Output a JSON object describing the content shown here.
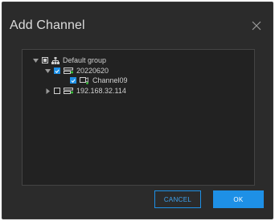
{
  "dialog": {
    "title": "Add Channel",
    "close_icon": "close-icon"
  },
  "tree": {
    "root": {
      "label": "Default group",
      "expanded": true,
      "checked": "partial",
      "icon": "group-hierarchy-icon"
    },
    "nodes": [
      {
        "label": "20220620",
        "expanded": true,
        "checked": true,
        "icon": "nvr-device-icon",
        "children": [
          {
            "label": "Channel09",
            "checked": true,
            "icon": "camera-channel-icon"
          }
        ]
      },
      {
        "label": "192.168.32.114",
        "expanded": false,
        "checked": false,
        "icon": "nvr-device-icon"
      }
    ]
  },
  "buttons": {
    "cancel_label": "CANCEL",
    "ok_label": "OK"
  },
  "colors": {
    "dialog_bg": "#2b2b2b",
    "panel_bg": "#222222",
    "accent": "#1e90e6",
    "device_green": "#37c23a"
  }
}
